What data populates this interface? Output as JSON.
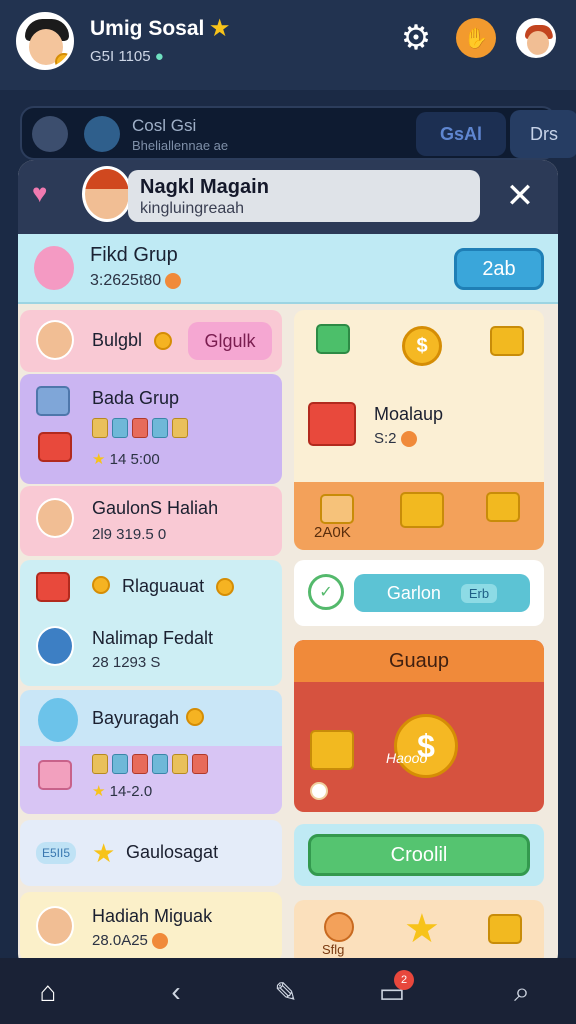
{
  "header": {
    "user_name": "Umig Sosal",
    "user_sub": "G5I 1105"
  },
  "background_strip": {
    "title": "Cosl Gsi",
    "subtitle": "Bheliallennae ae",
    "btn1": "GsAl",
    "btn2": "Drs"
  },
  "modal": {
    "title": "Nagkl Magain",
    "subtitle": "kingluingreaah",
    "friend": {
      "title": "Fikd Grup",
      "sub": "3:2625t80",
      "button": "2ab"
    },
    "left": [
      {
        "title": "Bulgbl",
        "button": "Glgulk"
      },
      {
        "title": "Bada Grup",
        "sub": "14 5:00"
      },
      {
        "title": "GaulonS Haliah",
        "sub": "2l9 319.5 0"
      },
      {
        "title": "Rlaguauat"
      },
      {
        "title": "Nalimap Fedalt",
        "sub": "28 1293 S"
      },
      {
        "title": "Bayuragah",
        "sub": "14-2.0"
      },
      {
        "tag": "E5II5",
        "title": "Gaulosagat"
      },
      {
        "title": "Hadiah Miguak",
        "sub": "28.0A25"
      }
    ],
    "right": [
      {
        "title": "Moalaup",
        "sub": "S:2",
        "footer": "2A0K"
      },
      {
        "button": "Garlon",
        "tag": "Erb"
      },
      {
        "title": "Guaup",
        "sub": "Haooo"
      },
      {
        "button": "Croolil"
      },
      {
        "footer": "Sflg"
      }
    ]
  },
  "nav": {
    "badge": "2"
  }
}
